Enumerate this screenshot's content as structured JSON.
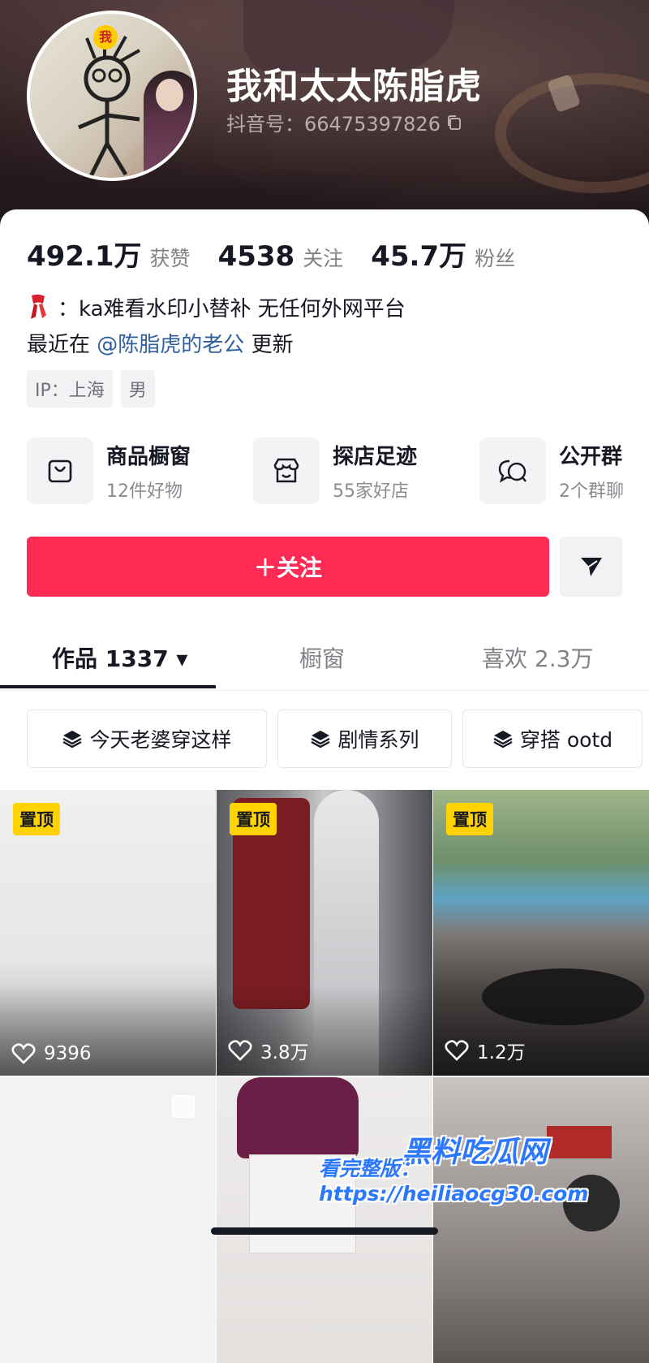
{
  "profile": {
    "name": "我和太太陈脂虎",
    "douyin_id": "抖音号：66475397826",
    "avatar_badge": "我"
  },
  "stats": [
    {
      "value": "492.1万",
      "label": "获赞"
    },
    {
      "value": "4538",
      "label": "关注"
    },
    {
      "value": "45.7万",
      "label": "粉丝"
    }
  ],
  "bio": {
    "line1": "：ka难看水印小替补 无任何外网平台",
    "line2_prefix": "最近在",
    "line2_mention": "@陈脂虎的老公",
    "line2_suffix": "更新"
  },
  "tags": [
    "IP：上海",
    "男"
  ],
  "shortcuts": [
    {
      "title": "商品橱窗",
      "sub": "12件好物",
      "icon": "shopping-bag-icon"
    },
    {
      "title": "探店足迹",
      "sub": "55家好店",
      "icon": "store-icon"
    },
    {
      "title": "公开群",
      "sub": "2个群聊",
      "icon": "group-chat-icon"
    }
  ],
  "follow_label": "＋关注",
  "tabs": [
    {
      "label": "作品 1337 ▾"
    },
    {
      "label": "橱窗"
    },
    {
      "label": "喜欢 2.3万"
    }
  ],
  "collections": [
    "今天老婆穿这样",
    "剧情系列",
    "穿搭 ootd"
  ],
  "videos": [
    {
      "pinned": "置顶",
      "likes": "9396"
    },
    {
      "pinned": "置顶",
      "likes": "3.8万"
    },
    {
      "pinned": "置顶",
      "likes": "1.2万"
    }
  ],
  "watermark": {
    "brand": "黑料吃瓜网",
    "text": "看完整版：https://heiliaocg30.com"
  },
  "colors": {
    "accent": "#fe2c55",
    "pin": "#ffd300",
    "mention": "#2f5f9e"
  }
}
